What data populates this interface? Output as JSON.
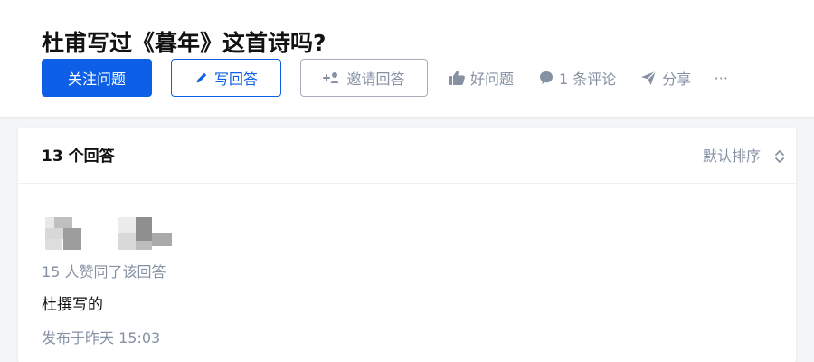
{
  "question": {
    "title": "杜甫写过《暮年》这首诗吗?"
  },
  "actions": {
    "follow_label": "关注问题",
    "write_answer_label": "写回答",
    "invite_answer_label": "邀请回答",
    "good_question_label": "好问题",
    "comments_label": "1 条评论",
    "share_label": "分享",
    "more_label": "···"
  },
  "answers": {
    "count_label": "13 个回答",
    "sort_label": "默认排序",
    "items": [
      {
        "vote_summary": "15 人赞同了该回答",
        "content": "杜撰写的",
        "publish_time": "发布于昨天 15:03"
      }
    ]
  },
  "icons": {
    "write": "pencil-icon",
    "invite": "add-user-icon",
    "good_question": "thumb-up-icon",
    "comment": "comment-icon",
    "share": "paper-plane-icon",
    "sort": "sort-icon"
  },
  "colors": {
    "primary": "#0d5fe8",
    "muted_text": "#8591a3",
    "page_background": "#f4f5f7",
    "card_background": "#ffffff"
  }
}
